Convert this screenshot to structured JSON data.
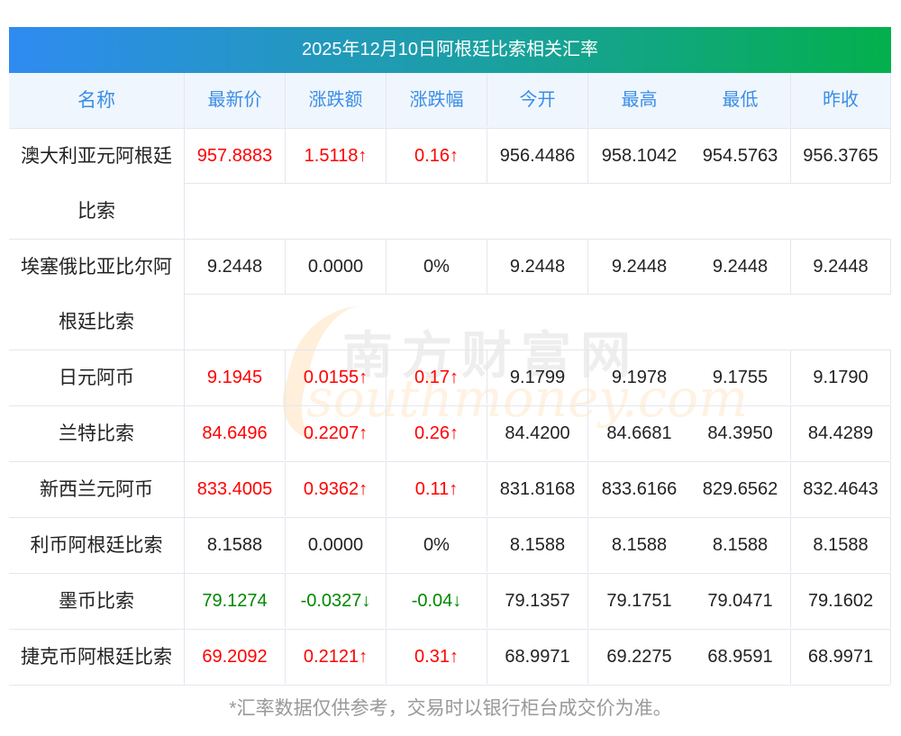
{
  "title": "2025年12月10日阿根廷比索相关汇率",
  "headers": [
    "名称",
    "最新价",
    "涨跌额",
    "涨跌幅",
    "今开",
    "最高",
    "最低",
    "昨收"
  ],
  "rows": [
    {
      "name": "澳大利亚元阿根廷比索",
      "values": [
        "957.8883",
        "1.5118↑",
        "0.16↑",
        "956.4486",
        "958.1042",
        "954.5763",
        "956.3765"
      ],
      "trend": "up"
    },
    {
      "name": "埃塞俄比亚比尔阿根廷比索",
      "values": [
        "9.2448",
        "0.0000",
        "0%",
        "9.2448",
        "9.2448",
        "9.2448",
        "9.2448"
      ],
      "trend": "flat"
    },
    {
      "name": "日元阿币",
      "values": [
        "9.1945",
        "0.0155↑",
        "0.17↑",
        "9.1799",
        "9.1978",
        "9.1755",
        "9.1790"
      ],
      "trend": "up"
    },
    {
      "name": "兰特比索",
      "values": [
        "84.6496",
        "0.2207↑",
        "0.26↑",
        "84.4200",
        "84.6681",
        "84.3950",
        "84.4289"
      ],
      "trend": "up"
    },
    {
      "name": "新西兰元阿币",
      "values": [
        "833.4005",
        "0.9362↑",
        "0.11↑",
        "831.8168",
        "833.6166",
        "829.6562",
        "832.4643"
      ],
      "trend": "up"
    },
    {
      "name": "利币阿根廷比索",
      "values": [
        "8.1588",
        "0.0000",
        "0%",
        "8.1588",
        "8.1588",
        "8.1588",
        "8.1588"
      ],
      "trend": "flat"
    },
    {
      "name": "墨币比索",
      "values": [
        "79.1274",
        "-0.0327↓",
        "-0.04↓",
        "79.1357",
        "79.1751",
        "79.0471",
        "79.1602"
      ],
      "trend": "down"
    },
    {
      "name": "捷克币阿根廷比索",
      "values": [
        "69.2092",
        "0.2121↑",
        "0.31↑",
        "68.9971",
        "69.2275",
        "68.9591",
        "68.9971"
      ],
      "trend": "up"
    }
  ],
  "footer": "*汇率数据仅供参考，交易时以银行柜台成交价为准。",
  "watermark": {
    "cn": "南方财富网",
    "en": "southmoney.com"
  },
  "colors": {
    "up": "#ff0000",
    "down": "#008800",
    "header_text": "#3a8ee6"
  }
}
